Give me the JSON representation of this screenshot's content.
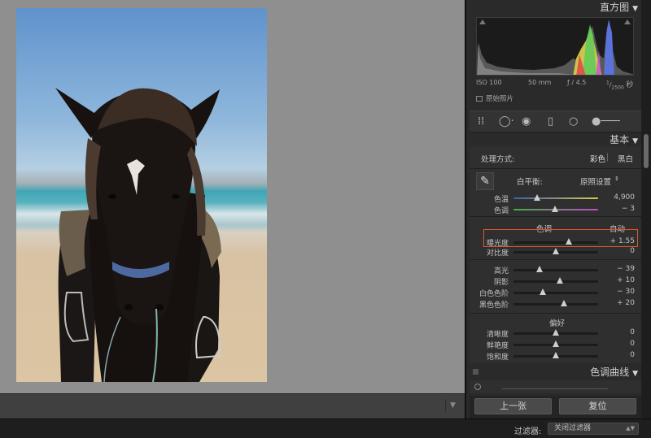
{
  "panel": {
    "histogram_title": "直方图",
    "histogram_info": {
      "iso": "ISO 100",
      "focal": "50 mm",
      "aperture": "ƒ / 4.5",
      "shutter_num": "1",
      "shutter_den": "2500",
      "shutter_unit": "秒"
    },
    "original_photo": "原始照片",
    "basic_title": "基本",
    "treatment_label": "处理方式:",
    "treatment_color": "彩色",
    "treatment_bw": "黑白",
    "wb_label": "白平衡:",
    "wb_value": "原照设置",
    "tone_label": "色调",
    "tone_auto": "自动",
    "presence_label": "偏好",
    "tone_curve_title": "色调曲线",
    "prev_button": "上一张",
    "reset_button": "复位"
  },
  "sliders": [
    {
      "label": "色温",
      "value": "4,900",
      "pos": 0.28
    },
    {
      "label": "色调",
      "value": "− 3",
      "pos": 0.49
    },
    {
      "label": "曝光度",
      "value": "+ 1.55",
      "pos": 0.65
    },
    {
      "label": "对比度",
      "value": "0",
      "pos": 0.5
    },
    {
      "label": "高光",
      "value": "− 39",
      "pos": 0.31
    },
    {
      "label": "阴影",
      "value": "+ 10",
      "pos": 0.55
    },
    {
      "label": "白色色阶",
      "value": "− 30",
      "pos": 0.35
    },
    {
      "label": "黑色色阶",
      "value": "+ 20",
      "pos": 0.6
    },
    {
      "label": "清晰度",
      "value": "0",
      "pos": 0.5
    },
    {
      "label": "鲜艳度",
      "value": "0",
      "pos": 0.5
    },
    {
      "label": "饱和度",
      "value": "0",
      "pos": 0.5
    }
  ],
  "bottom_bar": {
    "filter_label": "过滤器:",
    "filter_value": "关闭过滤器"
  },
  "colors": {
    "accent": "#e2572a",
    "panel_bg": "#2f2f2f",
    "canvas_bg": "#8f8f8f"
  }
}
